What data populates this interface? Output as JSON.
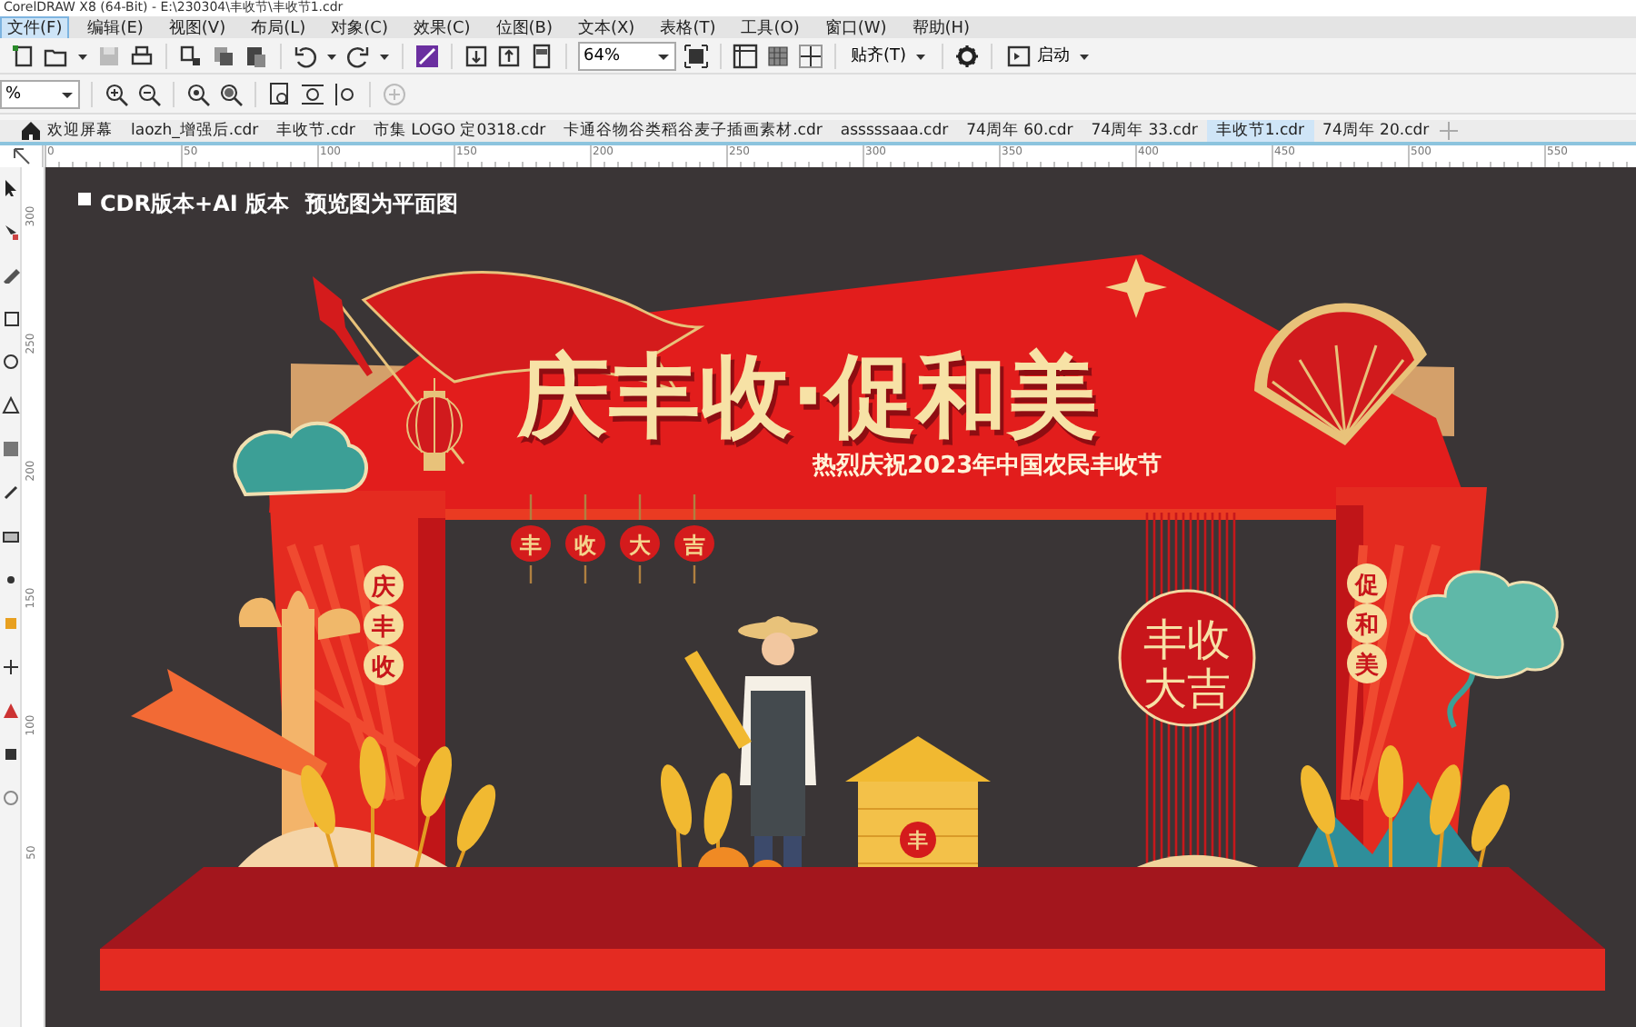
{
  "window": {
    "title": "CorelDRAW X8 (64-Bit) - E:\\230304\\丰收节\\丰收节1.cdr"
  },
  "menu": [
    {
      "label": "文件(F)",
      "selected": true
    },
    {
      "label": "编辑(E)",
      "selected": false
    },
    {
      "label": "视图(V)",
      "selected": false
    },
    {
      "label": "布局(L)",
      "selected": false
    },
    {
      "label": "对象(C)",
      "selected": false
    },
    {
      "label": "效果(C)",
      "selected": false
    },
    {
      "label": "位图(B)",
      "selected": false
    },
    {
      "label": "文本(X)",
      "selected": false
    },
    {
      "label": "表格(T)",
      "selected": false
    },
    {
      "label": "工具(O)",
      "selected": false
    },
    {
      "label": "窗口(W)",
      "selected": false
    },
    {
      "label": "帮助(H)",
      "selected": false
    }
  ],
  "toolbar": {
    "zoom": "64%",
    "snap": "贴齐(T)",
    "launch": "启动"
  },
  "zoom_toolbar": {
    "zoom_field": "%"
  },
  "tabs": [
    {
      "kind": "home",
      "label": "欢迎屏幕",
      "selected": false
    },
    {
      "kind": "document",
      "label": "laozh_增强后.cdr",
      "selected": false
    },
    {
      "kind": "document",
      "label": "丰收节.cdr",
      "selected": false
    },
    {
      "kind": "document",
      "label": "市集 LOGO 定0318.cdr",
      "selected": false
    },
    {
      "kind": "document",
      "label": "卡通谷物谷类稻谷麦子插画素材.cdr",
      "selected": false
    },
    {
      "kind": "document",
      "label": "asssssaaa.cdr",
      "selected": false
    },
    {
      "kind": "document",
      "label": "74周年 60.cdr",
      "selected": false
    },
    {
      "kind": "document",
      "label": "74周年 33.cdr",
      "selected": false
    },
    {
      "kind": "document",
      "label": "丰收节1.cdr",
      "selected": true
    },
    {
      "kind": "document",
      "label": "74周年 20.cdr",
      "selected": false
    }
  ],
  "rulers": {
    "horizontal": [
      "0",
      "50",
      "100",
      "150",
      "200",
      "250",
      "300",
      "350",
      "400",
      "450",
      "500",
      "550"
    ],
    "vertical": [
      "300",
      "250",
      "200",
      "150",
      "100",
      "50"
    ]
  },
  "artwork": {
    "note": "CDR版本+AI 版本",
    "note_2": "预览图为平面图",
    "title": "庆丰收·促和美",
    "subtitle": "热烈庆祝2023年中国农民丰收节",
    "lanterns": [
      "丰",
      "收",
      "大",
      "吉"
    ],
    "left_badges": [
      "庆",
      "丰",
      "收"
    ],
    "right_badges": [
      "促",
      "和",
      "美"
    ],
    "medallion": [
      "丰收",
      "大吉"
    ],
    "granary_label": "丰"
  }
}
